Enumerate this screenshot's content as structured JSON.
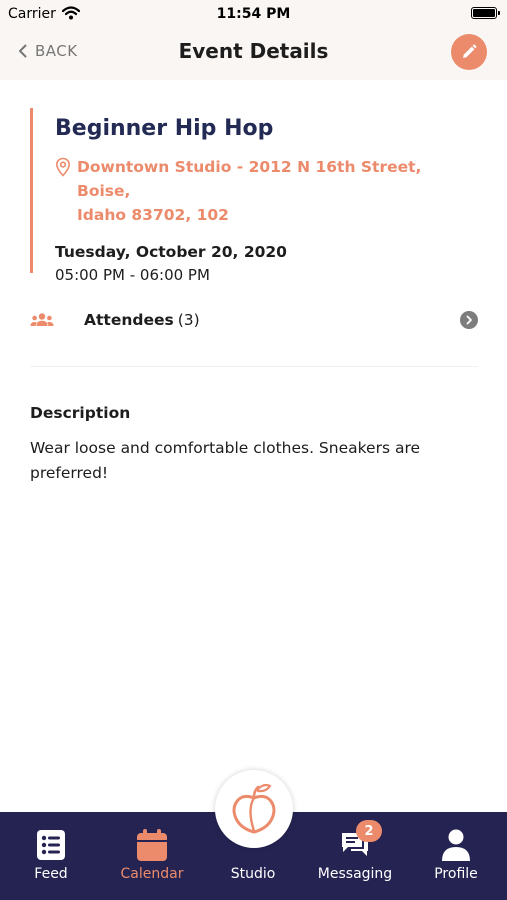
{
  "status_bar": {
    "carrier": "Carrier",
    "time": "11:54 PM"
  },
  "header": {
    "back_label": "BACK",
    "title": "Event Details"
  },
  "event": {
    "title": "Beginner Hip Hop",
    "location_line1": "Downtown Studio - 2012 N 16th Street, Boise,",
    "location_line2": "Idaho 83702, 102",
    "date": "Tuesday, October 20, 2020",
    "time": "05:00 PM - 06:00 PM"
  },
  "attendees": {
    "label": "Attendees",
    "count": "(3)"
  },
  "description": {
    "heading": "Description",
    "text": "Wear loose and comfortable clothes. Sneakers are preferred!"
  },
  "tabs": [
    {
      "label": "Feed",
      "icon": "feed-icon",
      "active": false
    },
    {
      "label": "Calendar",
      "icon": "calendar-icon",
      "active": true
    },
    {
      "label": "Studio",
      "icon": "peach-logo-icon",
      "active": false
    },
    {
      "label": "Messaging",
      "icon": "chat-icon",
      "active": false,
      "badge": "2"
    },
    {
      "label": "Profile",
      "icon": "person-icon",
      "active": false
    }
  ],
  "colors": {
    "accent": "#ec8b6b",
    "navy": "#232a54",
    "tab_bar": "#252352",
    "header_bg": "#faf6f3"
  }
}
